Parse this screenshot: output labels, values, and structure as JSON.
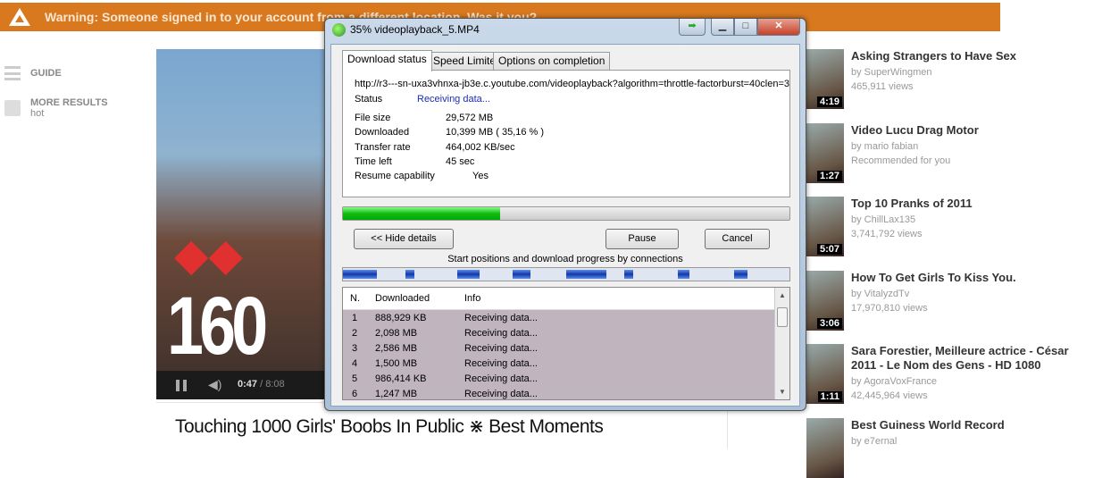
{
  "warning": {
    "text": "Warning: Someone signed in to your account from a different location. Was it you?",
    "color": "#d9791f",
    "icon": "warning-triangle-icon"
  },
  "sidebar": {
    "guide": "GUIDE",
    "more_results": "MORE RESULTS",
    "more_results_sub": "hot"
  },
  "player": {
    "overlay_text": "160",
    "time_current": "0:47",
    "time_total": "/ 8:08",
    "progress": 0.0965
  },
  "video_title": "Touching 1000 Girls' Boobs In Public ⋇ Best Moments",
  "related": [
    {
      "title": "Asking Strangers to Have Sex",
      "by": "by SuperWingmen",
      "meta": "465,911 views",
      "duration": "4:19"
    },
    {
      "title": "Video Lucu Drag Motor",
      "by": "by mario fabian",
      "meta": "Recommended for you",
      "duration": "1:27"
    },
    {
      "title": "Top 10 Pranks of 2011",
      "by": "by ChillLax135",
      "meta": "3,741,792 views",
      "duration": "5:07"
    },
    {
      "title": "How To Get Girls To Kiss You.",
      "by": "by VitalyzdTv",
      "meta": "17,970,810 views",
      "duration": "3:06"
    },
    {
      "title": "Sara Forestier, Meilleure actrice - César 2011 - Le Nom des Gens - HD 1080",
      "by": "by AgoraVoxFrance",
      "meta": "42,445,964 views",
      "duration": "1:11"
    },
    {
      "title": "Best Guiness World Record",
      "by": "by e7ernal",
      "meta": "",
      "duration": ""
    }
  ],
  "dialog": {
    "title": "35% videoplayback_5.MP4",
    "tabs": [
      "Download status",
      "Speed Limiter",
      "Options on completion"
    ],
    "url": "http://r3---sn-uxa3vhnxa-jb3e.c.youtube.com/videoplayback?algorithm=throttle-factorburst=40clen=3",
    "status_label": "Status",
    "status_value": "Receiving data...",
    "fields": [
      {
        "label": "File size",
        "value": "29,572  MB"
      },
      {
        "label": "Downloaded",
        "value": "10,399  MB  ( 35,16 % )"
      },
      {
        "label": "Transfer rate",
        "value": "464,002  KB/sec"
      },
      {
        "label": "Time left",
        "value": "45 sec"
      },
      {
        "label": "Resume capability",
        "value": "Yes"
      }
    ],
    "progress_percent": 35.16,
    "buttons": {
      "hide": "<< Hide details",
      "pause": "Pause",
      "cancel": "Cancel"
    },
    "connections_caption": "Start positions and download progress by connections",
    "table": {
      "headers": [
        "N.",
        "Downloaded",
        "Info"
      ],
      "rows": [
        {
          "n": "1",
          "downloaded": "888,929  KB",
          "info": "Receiving data..."
        },
        {
          "n": "2",
          "downloaded": "2,098  MB",
          "info": "Receiving data..."
        },
        {
          "n": "3",
          "downloaded": "2,586  MB",
          "info": "Receiving data..."
        },
        {
          "n": "4",
          "downloaded": "1,500  MB",
          "info": "Receiving data..."
        },
        {
          "n": "5",
          "downloaded": "986,414  KB",
          "info": "Receiving data..."
        },
        {
          "n": "6",
          "downloaded": "1,247  MB",
          "info": "Receiving data..."
        }
      ]
    }
  }
}
